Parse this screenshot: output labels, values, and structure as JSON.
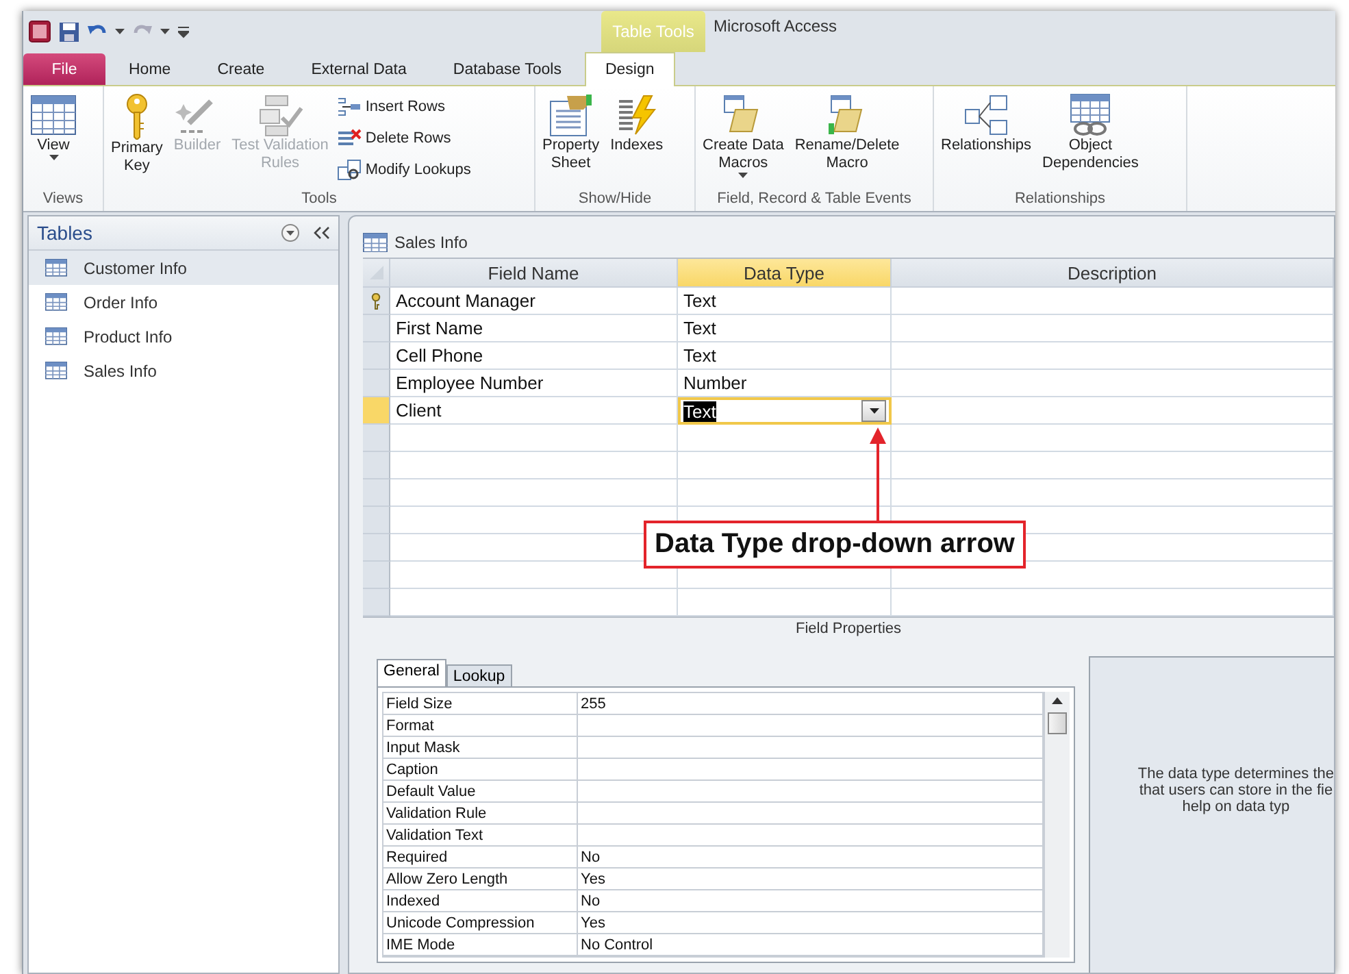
{
  "window": {
    "title": "Microsoft Access",
    "contextual_tab": "Table Tools"
  },
  "ribbon_tabs": [
    {
      "label": "File",
      "kind": "file",
      "selected": false
    },
    {
      "label": "Home",
      "kind": "tab",
      "selected": false
    },
    {
      "label": "Create",
      "kind": "tab",
      "selected": false
    },
    {
      "label": "External Data",
      "kind": "tab",
      "selected": false
    },
    {
      "label": "Database Tools",
      "kind": "tab",
      "selected": false
    },
    {
      "label": "Design",
      "kind": "contextual",
      "selected": true
    }
  ],
  "ribbon_groups": [
    {
      "label": "Views",
      "commands": [
        {
          "label": "View",
          "kind": "large",
          "dropdown": true,
          "disabled": false
        }
      ]
    },
    {
      "label": "Tools",
      "commands": [
        {
          "label": "Primary\nKey",
          "kind": "large",
          "dropdown": false,
          "disabled": false
        },
        {
          "label": "Builder",
          "kind": "large",
          "dropdown": false,
          "disabled": true
        },
        {
          "label": "Test Validation\nRules",
          "kind": "large",
          "dropdown": false,
          "disabled": true
        },
        {
          "label": "Insert Rows",
          "kind": "small",
          "dropdown": false,
          "disabled": false
        },
        {
          "label": "Delete Rows",
          "kind": "small",
          "dropdown": false,
          "disabled": false
        },
        {
          "label": "Modify Lookups",
          "kind": "small",
          "dropdown": false,
          "disabled": false
        }
      ]
    },
    {
      "label": "Show/Hide",
      "commands": [
        {
          "label": "Property\nSheet",
          "kind": "large",
          "dropdown": false,
          "disabled": false
        },
        {
          "label": "Indexes",
          "kind": "large",
          "dropdown": false,
          "disabled": false
        }
      ]
    },
    {
      "label": "Field, Record & Table Events",
      "commands": [
        {
          "label": "Create Data\nMacros",
          "kind": "large",
          "dropdown": true,
          "disabled": false
        },
        {
          "label": "Rename/Delete\nMacro",
          "kind": "large",
          "dropdown": false,
          "disabled": false
        }
      ]
    },
    {
      "label": "Relationships",
      "commands": [
        {
          "label": "Relationships",
          "kind": "large",
          "dropdown": false,
          "disabled": false
        },
        {
          "label": "Object\nDependencies",
          "kind": "large",
          "dropdown": false,
          "disabled": false
        }
      ]
    }
  ],
  "navigation_pane": {
    "title": "Tables",
    "items": [
      {
        "label": "Customer Info",
        "selected": true
      },
      {
        "label": "Order Info",
        "selected": false
      },
      {
        "label": "Product Info",
        "selected": false
      },
      {
        "label": "Sales Info",
        "selected": false
      }
    ]
  },
  "document": {
    "tab": "Sales Info",
    "columns": [
      {
        "label": "Field Name",
        "selected": false
      },
      {
        "label": "Data Type",
        "selected": true
      },
      {
        "label": "Description",
        "selected": false
      }
    ],
    "rows": [
      {
        "field_name": "Account Manager",
        "data_type": "Text",
        "primary_key": true,
        "selected": false
      },
      {
        "field_name": "First Name",
        "data_type": "Text",
        "primary_key": false,
        "selected": false
      },
      {
        "field_name": "Cell Phone",
        "data_type": "Text",
        "primary_key": false,
        "selected": false
      },
      {
        "field_name": "Employee Number",
        "data_type": "Number",
        "primary_key": false,
        "selected": false
      },
      {
        "field_name": "Client",
        "data_type": "Text",
        "primary_key": false,
        "selected": true
      }
    ]
  },
  "field_properties": {
    "title": "Field Properties",
    "tabs": [
      {
        "label": "General",
        "selected": true
      },
      {
        "label": "Lookup",
        "selected": false
      }
    ],
    "properties": [
      {
        "name": "Field Size",
        "value": "255"
      },
      {
        "name": "Format"
      },
      {
        "name": "Input Mask"
      },
      {
        "name": "Caption"
      },
      {
        "name": "Default Value"
      },
      {
        "name": "Validation Rule"
      },
      {
        "name": "Validation Text"
      },
      {
        "name": "Required",
        "value": "No"
      },
      {
        "name": "Allow Zero Length",
        "value": "Yes"
      },
      {
        "name": "Indexed",
        "value": "No"
      },
      {
        "name": "Unicode Compression",
        "value": "Yes"
      },
      {
        "name": "IME Mode",
        "value": "No Control"
      }
    ],
    "help_lines": [
      "The data type determines the",
      "that users can store in the fie",
      "help on data typ"
    ]
  },
  "callout": {
    "text": "Data Type drop-down arrow"
  }
}
